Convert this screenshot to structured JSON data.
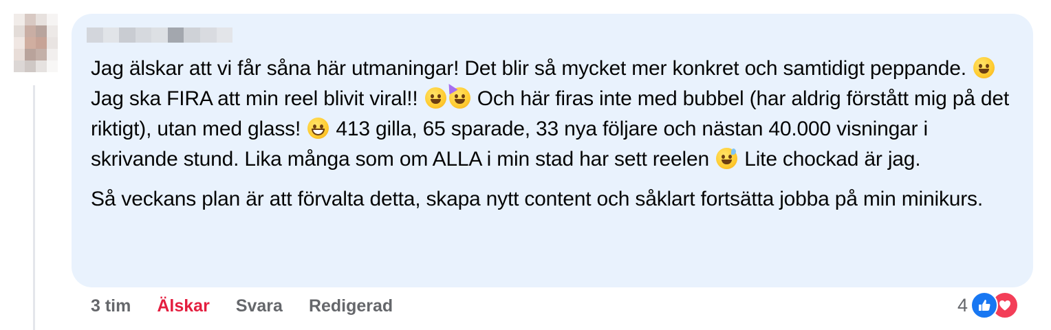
{
  "comment": {
    "paragraphs": [
      {
        "segments": [
          "Jag älskar att vi får såna här utmaningar! Det blir så mycket mer konkret och samtidigt peppande.",
          " Jag ska FIRA att min reel blivit viral!!",
          " Och här firas inte med bubbel (har aldrig förstått mig på det riktigt), utan med glass!",
          " 413 gilla, 65 sparade, 33 nya följare och nästan 40.000 visningar i skrivande stund. Lika många som om ALLA i min stad har sett reelen",
          " Lite chockad är jag."
        ]
      },
      {
        "text": "Så veckans plan är att förvalta detta, skapa nytt content och såklart fortsätta jobba på min minikurs."
      }
    ],
    "emoji_icons": [
      "smiling-face-icon",
      "grinning-face-icon",
      "partying-face-icon",
      "beaming-face-icon",
      "grinning-sweat-icon"
    ]
  },
  "actions": {
    "time": "3 tim",
    "love": "Älskar",
    "reply": "Svara",
    "edited": "Redigerad"
  },
  "reactions": {
    "count": "4",
    "icons": [
      "thumbs-up-icon",
      "heart-icon"
    ]
  },
  "colors": {
    "bubble": "#e9f2fd",
    "love_accent": "#e41e3f",
    "muted": "#65676b",
    "like_blue": "#1877f2",
    "heart_red": "#f33e58"
  }
}
